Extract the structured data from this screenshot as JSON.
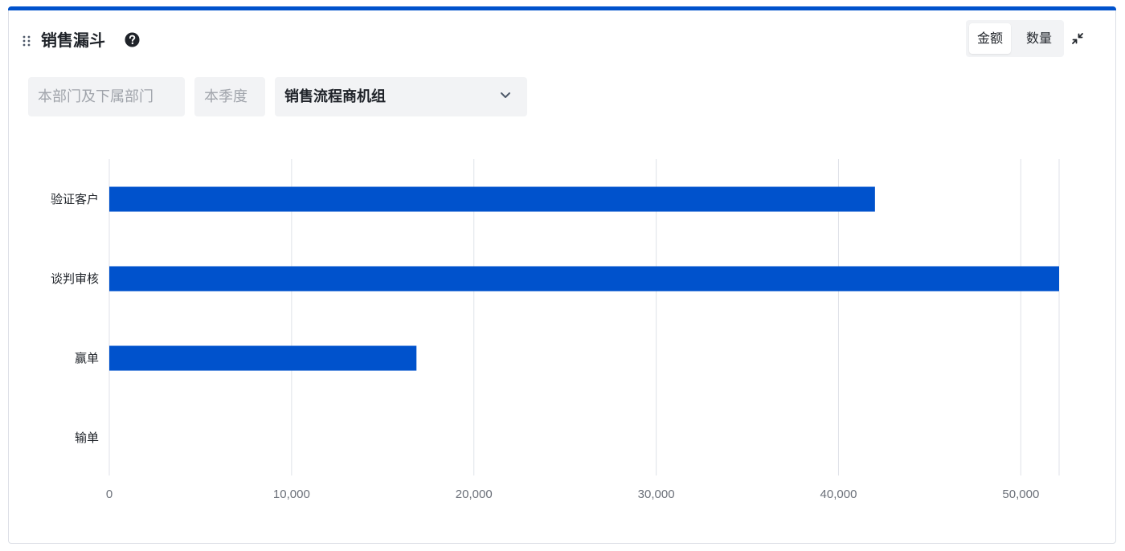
{
  "header": {
    "title": "销售漏斗"
  },
  "toggle": {
    "amount_label": "金额",
    "count_label": "数量",
    "active": "amount"
  },
  "filters": {
    "department": "本部门及下属部门",
    "period": "本季度",
    "group": "销售流程商机组"
  },
  "colors": {
    "accent": "#0052cc",
    "bar": "#0052cc",
    "grid": "#dfe2e8"
  },
  "chart_data": {
    "type": "bar",
    "orientation": "horizontal",
    "categories": [
      "验证客户",
      "谈判审核",
      "赢单",
      "输单"
    ],
    "values": [
      42000,
      52100,
      16850,
      0
    ],
    "xlim": [
      0,
      52100
    ],
    "xticks": [
      0,
      10000,
      20000,
      30000,
      40000,
      50000
    ],
    "xtick_labels": [
      "0",
      "10,000",
      "20,000",
      "30,000",
      "40,000",
      "50,000"
    ],
    "title": "",
    "xlabel": "",
    "ylabel": "",
    "grid": true,
    "legend": "none"
  }
}
